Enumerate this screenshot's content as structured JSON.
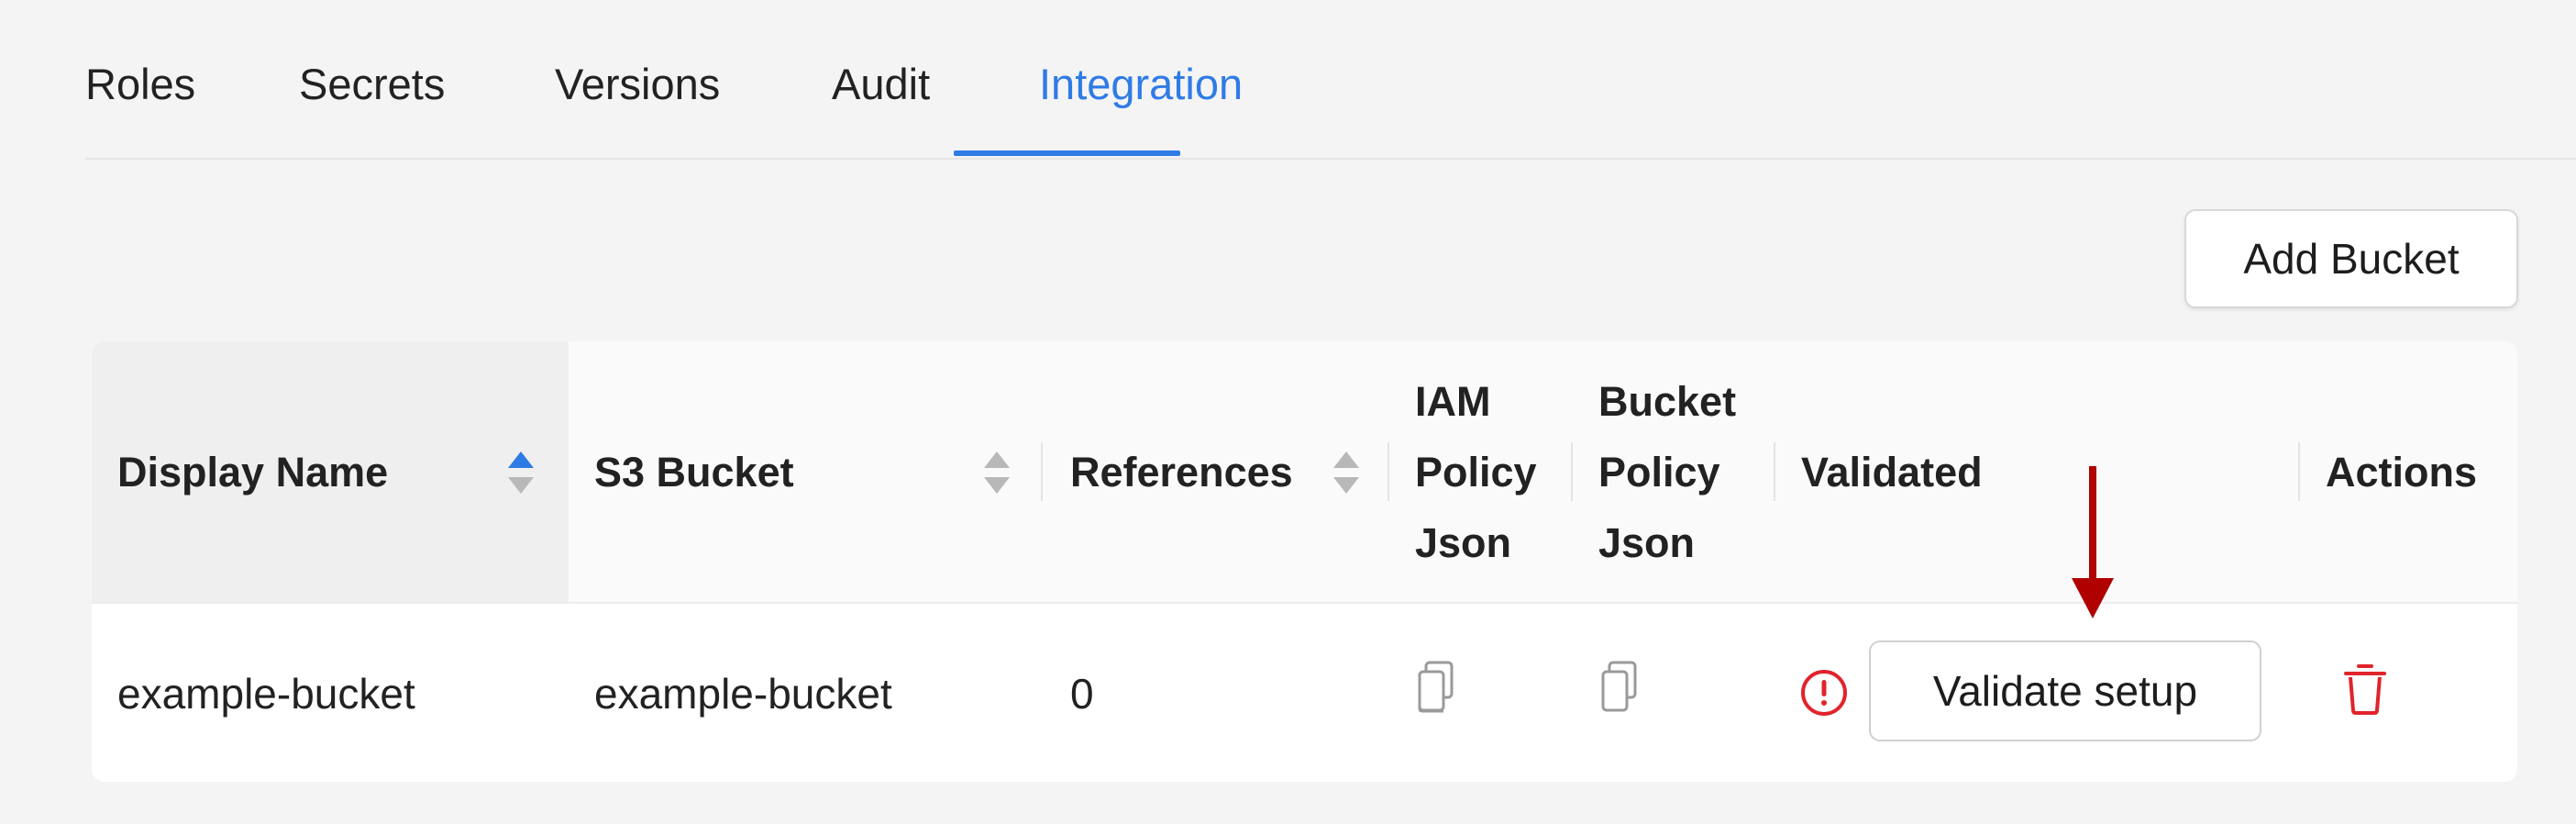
{
  "tabs": [
    {
      "label": "Roles"
    },
    {
      "label": "Secrets"
    },
    {
      "label": "Versions"
    },
    {
      "label": "Audit"
    },
    {
      "label": "Integration",
      "active": true
    }
  ],
  "toolbar": {
    "add_bucket_label": "Add Bucket"
  },
  "table": {
    "headers": {
      "display_name": "Display Name",
      "s3_bucket": "S3 Bucket",
      "references": "References",
      "iam_policy_json": [
        "IAM",
        "Policy",
        "Json"
      ],
      "bucket_policy_json": [
        "Bucket",
        "Policy",
        "Json"
      ],
      "validated": "Validated",
      "actions": "Actions"
    },
    "sort": {
      "column": "display_name",
      "direction": "ascending"
    },
    "rows": [
      {
        "display_name": "example-bucket",
        "s3_bucket": "example-bucket",
        "references": "0",
        "validated_status": "not-validated",
        "validate_button": "Validate setup"
      }
    ]
  },
  "colors": {
    "accent": "#2f7be6",
    "warning": "#e0242b",
    "annotation_arrow": "#b00000"
  },
  "icons": {
    "copy": "copy-icon",
    "warning": "exclamation-circle-icon",
    "delete": "trash-icon",
    "annotation": "arrow-down-icon"
  }
}
